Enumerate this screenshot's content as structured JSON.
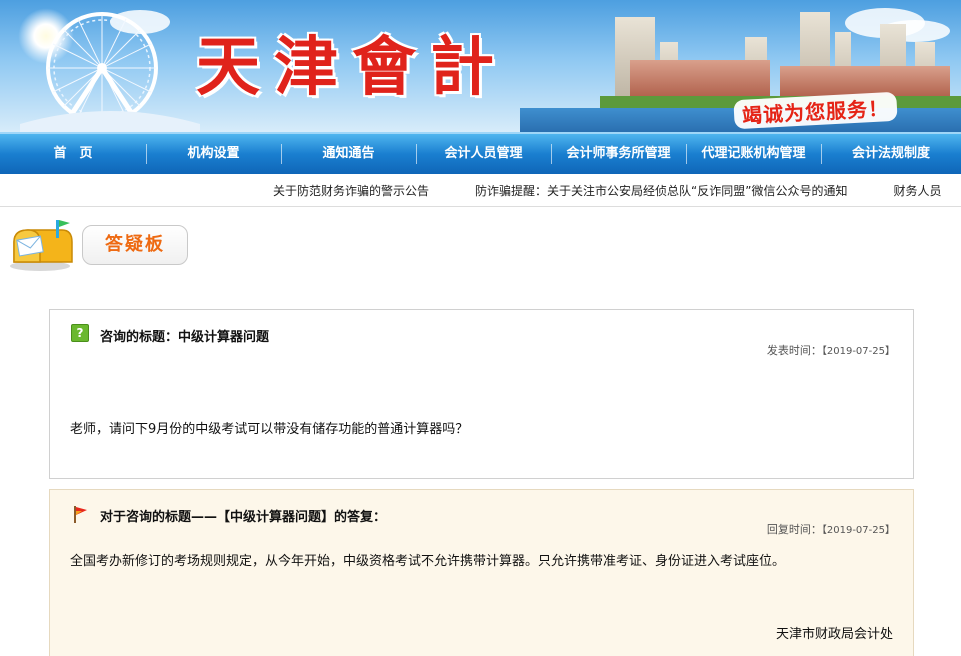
{
  "header": {
    "logo_chars": [
      "天",
      "津",
      "會",
      "計"
    ],
    "slogan": "竭诚为您服务！"
  },
  "nav": {
    "items": [
      {
        "label": "首　页"
      },
      {
        "label": "机构设置"
      },
      {
        "label": "通知通告"
      },
      {
        "label": "会计人员管理"
      },
      {
        "label": "会计师事务所管理"
      },
      {
        "label": "代理记账机构管理"
      },
      {
        "label": "会计法规制度"
      }
    ]
  },
  "ticker": {
    "items": [
      "关于防范财务诈骗的警示公告",
      "防诈骗提醒：关于关注市公安局经侦总队“反诈同盟”微信公众号的通知",
      "财务人员"
    ]
  },
  "section": {
    "title": "答疑板"
  },
  "question": {
    "title": "咨询的标题：中级计算器问题",
    "time_label": "发表时间：",
    "time_value": "【2019-07-25】",
    "body": "老师，请问下9月份的中级考试可以带没有储存功能的普通计算器吗？"
  },
  "answer": {
    "title": "对于咨询的标题——【中级计算器问题】的答复：",
    "time_label": "回复时间：",
    "time_value": "【2019-07-25】",
    "body": "全国考办新修订的考场规则规定，从今年开始，中级资格考试不允许携带计算器。只允许携带准考证、身份证进入考试座位。",
    "signer": "天津市财政局会计处"
  },
  "colors": {
    "nav_blue": "#1a7fd0",
    "logo_red": "#e0231b",
    "section_orange": "#ee6a12",
    "answer_bg": "#fdf7ea"
  }
}
